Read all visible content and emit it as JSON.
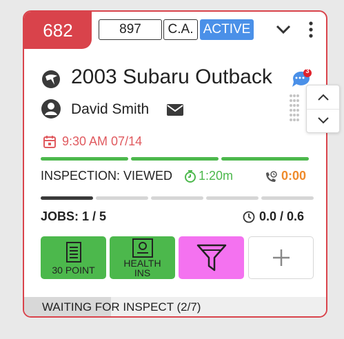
{
  "card": {
    "number": "682",
    "tag": "897",
    "code": "C.A.",
    "status": "ACTIVE",
    "vehicle": "2003 Subaru Outback",
    "message_count": "3",
    "owner": "David Smith",
    "appointment": "9:30 AM 07/14",
    "inspection_status": "INSPECTION: VIEWED",
    "timer": "1:20m",
    "call_time": "0:00",
    "jobs": "JOBS: 1 / 5",
    "hours": "0.0 / 0.6",
    "tiles": [
      {
        "label": "30 POINT"
      },
      {
        "label_line1": "HEALTH",
        "label_line2": "INS"
      }
    ],
    "footer": "WAITING FOR INSPECT (2/7)",
    "footer_progress": 0.29,
    "top_progress": [
      1,
      1,
      1
    ],
    "jobs_progress": [
      1,
      0,
      0,
      0,
      0
    ],
    "colors": {
      "accent_red": "#d9434b",
      "active_blue": "#4a90e8",
      "green": "#4cb84c",
      "magenta": "#f472f0",
      "orange": "#ef8a2a"
    }
  }
}
